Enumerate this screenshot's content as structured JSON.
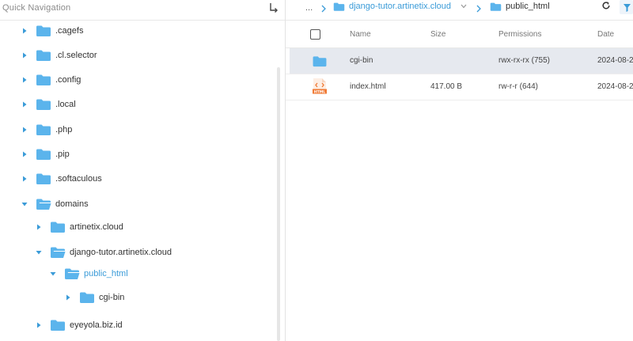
{
  "quick_nav": {
    "title": "Quick Navigation",
    "collapse_icon": "collapse-arrow-icon",
    "tree": [
      {
        "label": ".cagefs",
        "expanded": false
      },
      {
        "label": ".cl.selector",
        "expanded": false
      },
      {
        "label": ".config",
        "expanded": false
      },
      {
        "label": ".local",
        "expanded": false
      },
      {
        "label": ".php",
        "expanded": false
      },
      {
        "label": ".pip",
        "expanded": false
      },
      {
        "label": ".softaculous",
        "expanded": false
      },
      {
        "label": "domains",
        "expanded": true
      },
      {
        "label": "artinetix.cloud",
        "expanded": false
      },
      {
        "label": "django-tutor.artinetix.cloud",
        "expanded": true
      },
      {
        "label": "public_html",
        "expanded": true,
        "active": true
      },
      {
        "label": "cgi-bin",
        "expanded": false
      },
      {
        "label": "eyeyola.biz.id",
        "expanded": false
      }
    ]
  },
  "breadcrumb": {
    "ellipsis": "...",
    "parent": "django-tutor.artinetix.cloud",
    "current": "public_html"
  },
  "toolbar": {
    "refresh_icon": "refresh-icon",
    "filter_icon": "filter-icon"
  },
  "table": {
    "columns": {
      "name": "Name",
      "size": "Size",
      "permissions": "Permissions",
      "date": "Date"
    },
    "rows": [
      {
        "type": "folder",
        "name": "cgi-bin",
        "size": "",
        "permissions": "rwx-rx-rx (755)",
        "date": "2024-08-2",
        "selected": true
      },
      {
        "type": "html",
        "icon_text": "HTML",
        "name": "index.html",
        "size": "417.00 B",
        "permissions": "rw-r-r (644)",
        "date": "2024-08-2",
        "selected": false
      }
    ]
  },
  "colors": {
    "folder": "#5bb4ec",
    "link": "#3a9bd8",
    "selected_row": "#e6e9ef",
    "html_icon": "#f07a35"
  }
}
